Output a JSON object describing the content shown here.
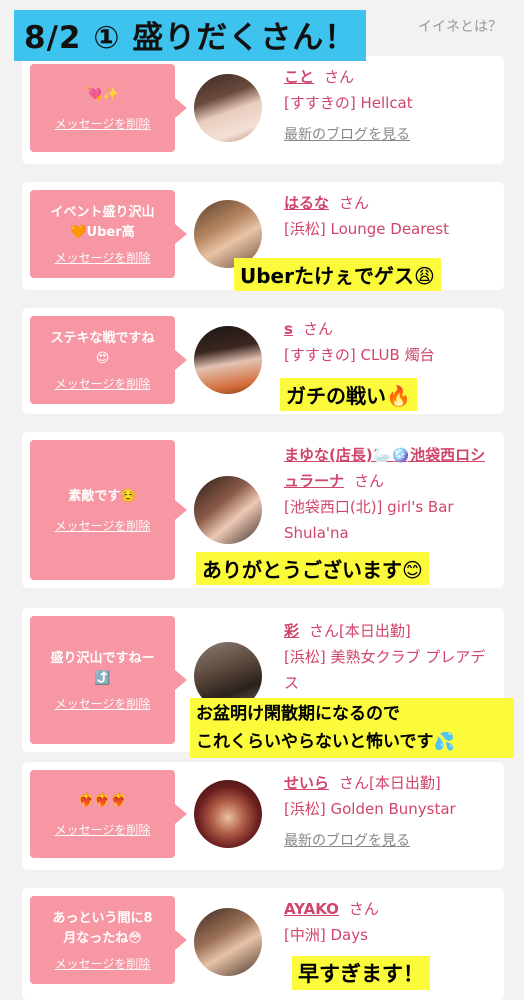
{
  "header": {
    "banner": "8/2 ① 盛りだくさん！",
    "top_link": "イイネとは？"
  },
  "common": {
    "delete_label": "メッセージを削除",
    "san": "さん",
    "blog_link": "最新のブログを見る"
  },
  "cards": [
    {
      "message": "💘✨",
      "name": "こと",
      "status": "",
      "shop": "[すすきの] Hellcat",
      "caption": ""
    },
    {
      "message": "イベント盛り沢山\n🧡Uber高",
      "name": "はるな",
      "status": "",
      "shop": "[浜松] Lounge Dearest",
      "caption": "Uberたけぇでゲス😩"
    },
    {
      "message": "ステキな戦ですね\n😍",
      "name": "s",
      "status": "",
      "shop": "[すすきの] CLUB 燭台",
      "caption": "ガチの戦い🔥"
    },
    {
      "message": "素敵です☺️",
      "name": "まゆな(店長)🦢🪩池袋西ロシュラーナ",
      "status": "",
      "shop": "[池袋西口(北)] girl's Bar Shula'na",
      "caption": "ありがとうございます😊"
    },
    {
      "message": "盛り沢山ですねー\n⤴️",
      "name": "彩",
      "status": "[本日出勤]",
      "shop": "[浜松] 美熟女クラブ プレアデス",
      "caption": "お盆明け閑散期になるので\nこれくらいやらないと怖いです💦"
    },
    {
      "message": "❤️‍🔥❤️‍🔥❤️‍🔥",
      "name": "せいら",
      "status": "[本日出勤]",
      "shop": "[浜松] Golden Bunystar",
      "caption": ""
    },
    {
      "message": "あっという間に8\n月なったね😳",
      "name": "AYAKO",
      "status": "",
      "shop": "[中洲] Days",
      "caption": "早すぎます！"
    }
  ]
}
